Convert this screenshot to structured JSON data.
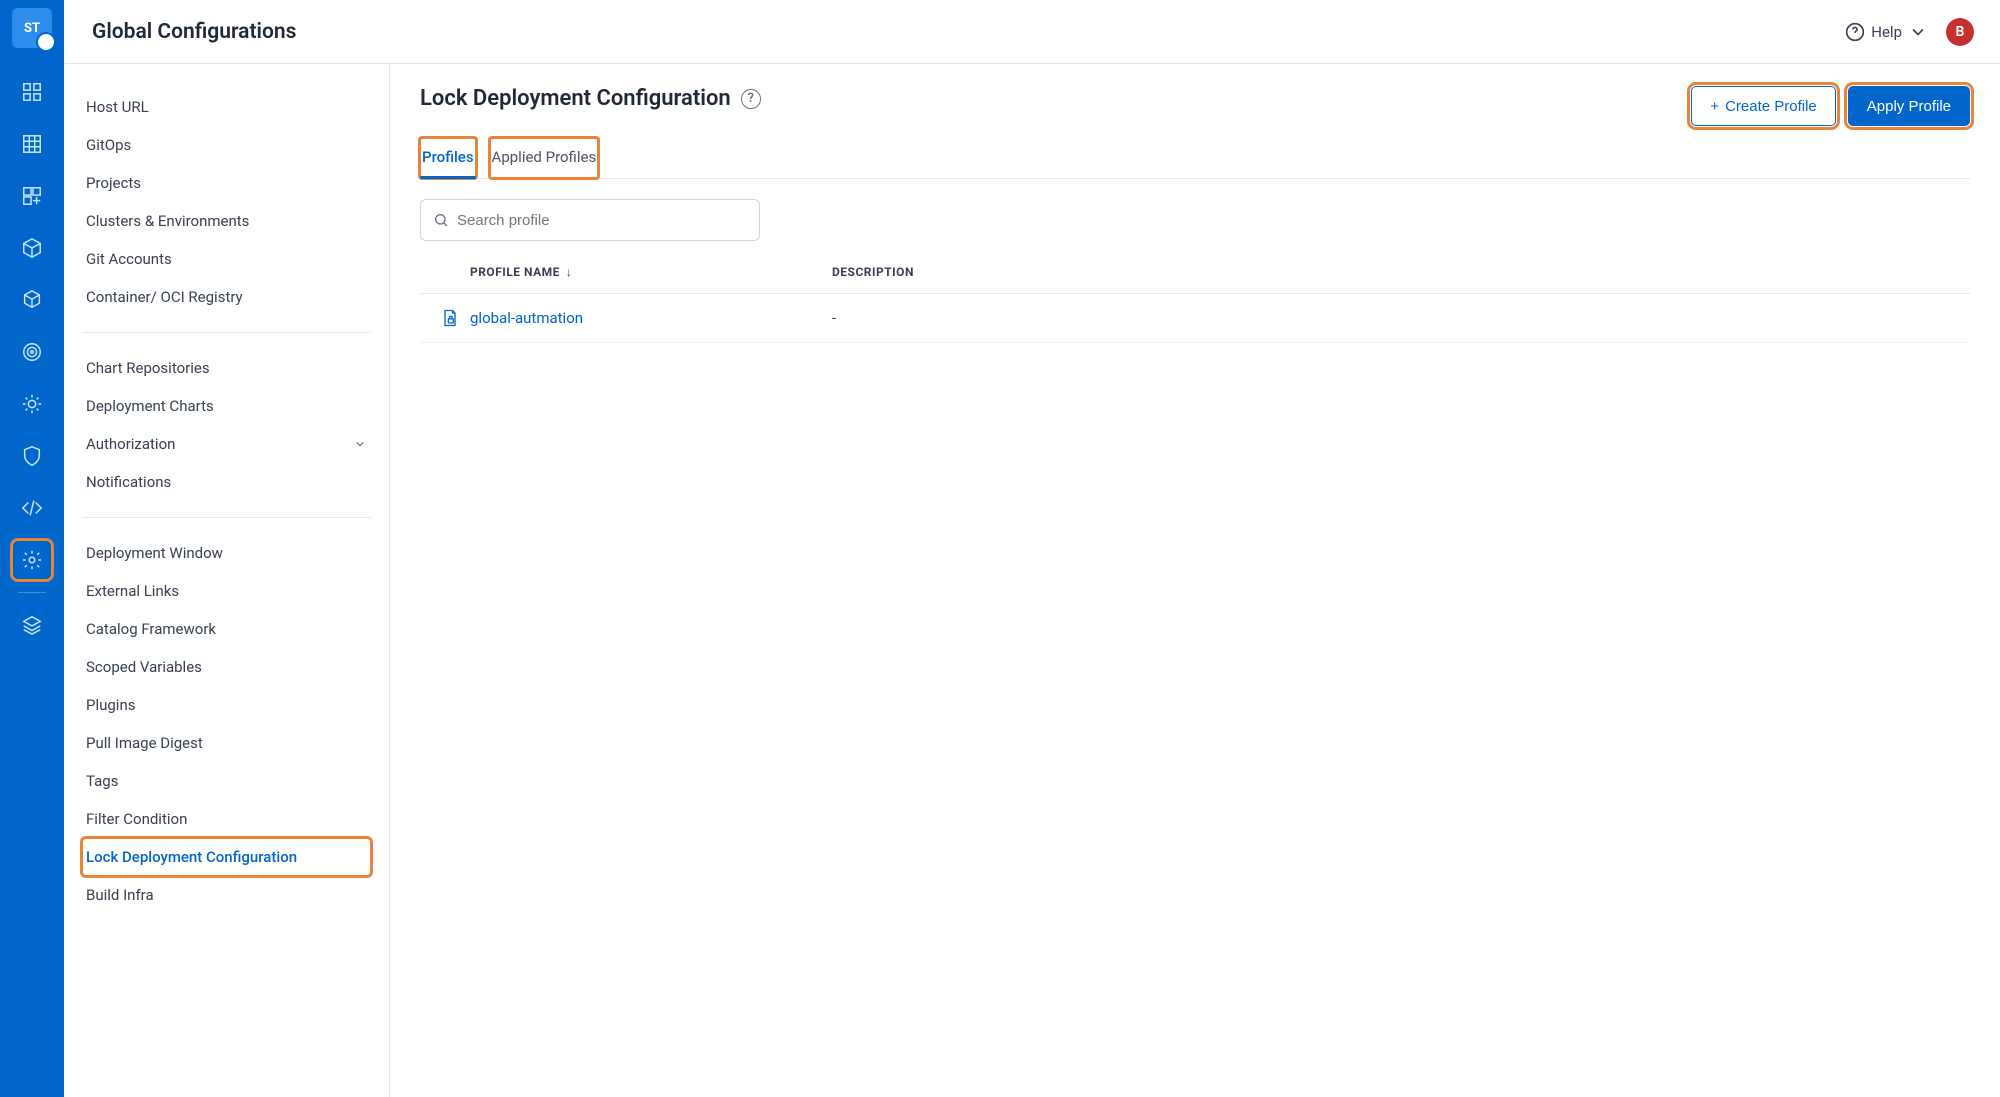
{
  "header": {
    "title": "Global Configurations",
    "help_label": "Help",
    "avatar_initial": "B"
  },
  "leftnav": {
    "logo_text": "ST",
    "items": [
      {
        "name": "dashboard-icon"
      },
      {
        "name": "grid-icon"
      },
      {
        "name": "apps-icon"
      },
      {
        "name": "package-icon"
      },
      {
        "name": "cube-icon"
      },
      {
        "name": "target-icon"
      },
      {
        "name": "sun-icon"
      },
      {
        "name": "shield-icon"
      },
      {
        "name": "code-icon"
      },
      {
        "name": "gear-icon"
      },
      {
        "name": "layers-icon"
      }
    ],
    "active_index": 9
  },
  "sidebar": {
    "groups": [
      [
        "Host URL",
        "GitOps",
        "Projects",
        "Clusters & Environments",
        "Git Accounts",
        "Container/ OCI Registry"
      ],
      [
        "Chart Repositories",
        "Deployment Charts",
        "Authorization",
        "Notifications"
      ],
      [
        "Deployment Window",
        "External Links",
        "Catalog Framework",
        "Scoped Variables",
        "Plugins",
        "Pull Image Digest",
        "Tags",
        "Filter Condition",
        "Lock Deployment Configuration",
        "Build Infra"
      ]
    ],
    "expandable": {
      "Authorization": true
    },
    "active": "Lock Deployment Configuration"
  },
  "content": {
    "title": "Lock Deployment Configuration",
    "buttons": {
      "create": "Create Profile",
      "apply": "Apply Profile"
    },
    "tabs": [
      {
        "label": "Profiles",
        "active": true
      },
      {
        "label": "Applied Profiles",
        "active": false
      }
    ],
    "search_placeholder": "Search profile",
    "columns": {
      "name": "PROFILE NAME",
      "desc": "DESCRIPTION"
    },
    "rows": [
      {
        "name": "global-autmation",
        "desc": "-"
      }
    ]
  }
}
